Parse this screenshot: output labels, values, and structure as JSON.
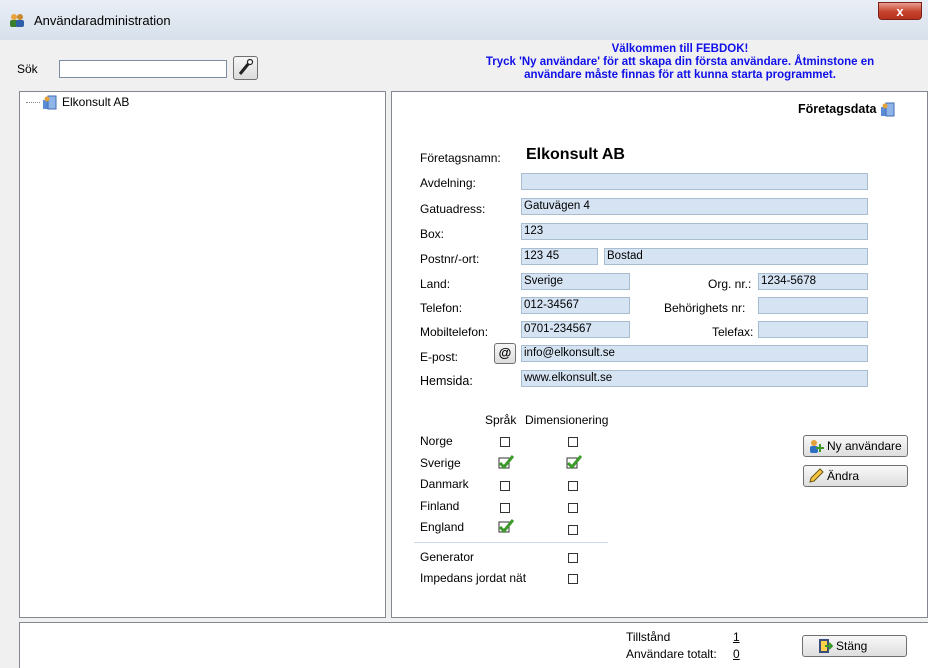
{
  "window": {
    "title": "Användaradministration",
    "close_glyph": "x"
  },
  "search": {
    "label": "Sök",
    "value": "",
    "placeholder": ""
  },
  "welcome": {
    "line1": "Välkommen till FEBDOK!",
    "line2": "Tryck 'Ny användare' för att skapa din första användare. Åtminstone en",
    "line3": "användare måste finnas för att kunna starta programmet."
  },
  "tree": {
    "items": [
      {
        "label": "Elkonsult AB",
        "icon": "company-icon"
      }
    ]
  },
  "detail": {
    "header": "Företagsdata",
    "company_label": "Företagsnamn:",
    "company_name": "Elkonsult AB",
    "fields": {
      "avdelning": {
        "label": "Avdelning:",
        "value": ""
      },
      "gatuadress": {
        "label": "Gatuadress:",
        "value": "Gatuvägen 4"
      },
      "box": {
        "label": "Box:",
        "value": "123"
      },
      "postnr": {
        "label": "Postnr/-ort:",
        "value": "123 45",
        "ort": "Bostad"
      },
      "land": {
        "label": "Land:",
        "value": "Sverige"
      },
      "orgnr": {
        "label": "Org. nr.:",
        "value": "1234-5678"
      },
      "telefon": {
        "label": "Telefon:",
        "value": "012-34567"
      },
      "behorighet": {
        "label": "Behörighets nr:",
        "value": ""
      },
      "mobil": {
        "label": "Mobiltelefon:",
        "value": "0701-234567"
      },
      "telefax": {
        "label": "Telefax:",
        "value": ""
      },
      "epost": {
        "label": "E-post:",
        "value": "info@elkonsult.se",
        "button": "@"
      },
      "hemsida": {
        "label": "Hemsida:",
        "value": "www.elkonsult.se"
      }
    },
    "columns": {
      "sprak": "Språk",
      "dim": "Dimensionering"
    },
    "countries": [
      {
        "name": "Norge",
        "sprak": false,
        "dim": false
      },
      {
        "name": "Sverige",
        "sprak": true,
        "dim": true
      },
      {
        "name": "Danmark",
        "sprak": false,
        "dim": false
      },
      {
        "name": "Finland",
        "sprak": false,
        "dim": false
      },
      {
        "name": "England",
        "sprak": true,
        "dim": false
      }
    ],
    "options": [
      {
        "name": "Generator",
        "checked": false
      },
      {
        "name": "Impedans jordat nät",
        "checked": false
      }
    ],
    "buttons": {
      "new_user": "Ny användare",
      "edit": "Ändra"
    }
  },
  "footer": {
    "tillstand_label": "Tillstånd",
    "tillstand_value": "1",
    "total_label": "Användare totalt:",
    "total_value": "0",
    "close_button": "Stäng"
  },
  "colors": {
    "field_bg": "#d5e3f2",
    "welcome_text": "#1010e8",
    "close_btn": "#c5412c"
  }
}
